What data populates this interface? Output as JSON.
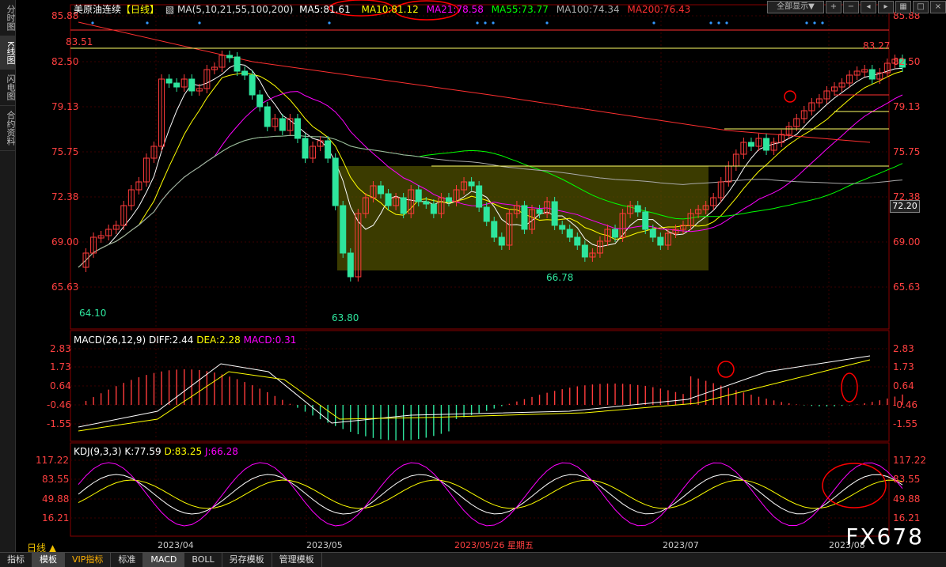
{
  "left_tabs": [
    {
      "label": "分时图",
      "active": false
    },
    {
      "label": "K线图",
      "active": true
    },
    {
      "label": "闪电图",
      "active": false
    },
    {
      "label": "合约资料",
      "active": false
    }
  ],
  "header": {
    "instrument": "美原油连续",
    "period_tag": "【日线】",
    "ma_title": "MA(5,10,21,55,100,200)",
    "ma_values": [
      {
        "text": "MA5:81.61",
        "color": "#ffffff"
      },
      {
        "text": "MA10:81.12",
        "color": "#ffff00"
      },
      {
        "text": "MA21:78.58",
        "color": "#ff00ff"
      },
      {
        "text": "MA55:73.77",
        "color": "#00ff00"
      },
      {
        "text": "MA100:74.34",
        "color": "#aaaaaa"
      },
      {
        "text": "MA200:76.43",
        "color": "#ff3030"
      }
    ]
  },
  "toolbar": {
    "select_label": "全部显示▼",
    "icons": [
      "plus-icon",
      "minus-icon",
      "left-icon",
      "right-icon",
      "grid-icon",
      "box-icon",
      "close-icon"
    ]
  },
  "axes": {
    "price_ticks": [
      "85.88",
      "82.50",
      "79.13",
      "75.75",
      "72.38",
      "69.00",
      "65.63"
    ],
    "macd_ticks": [
      "2.83",
      "1.73",
      "0.64",
      "-0.46",
      "-1.55"
    ],
    "kdj_ticks": [
      "117.22",
      "83.55",
      "49.88",
      "16.21"
    ],
    "date_labels": [
      "2023/04",
      "2023/05",
      "2023/05/26 星期五",
      "2023/07",
      "2023/08"
    ],
    "current_price": "72.20"
  },
  "annotations": {
    "high1": "83.51",
    "low1": "64.10",
    "low2": "63.80",
    "low3": "66.78",
    "high2": "83.27"
  },
  "macd": {
    "title": "MACD(26,12,9)",
    "diff": "DIFF:2.44",
    "dea": "DEA:2.28",
    "macd": "MACD:0.31"
  },
  "kdj": {
    "title": "KDJ(9,3,3)",
    "k": "K:77.59",
    "d": "D:83.25",
    "j": "J:66.28"
  },
  "period_label": "日线 ▲",
  "bottom_tabs": [
    {
      "label": "指标",
      "active": false
    },
    {
      "label": "模板",
      "active": true
    },
    {
      "label": "VIP指标",
      "active": false
    },
    {
      "label": "标准",
      "active": false
    },
    {
      "label": "MACD",
      "active": true
    },
    {
      "label": "BOLL",
      "active": false
    },
    {
      "label": "另存模板",
      "active": false
    },
    {
      "label": "管理模板",
      "active": false
    }
  ],
  "watermark": "FX678",
  "colors": {
    "up": "#ff3b3b",
    "down": "#2ee59d",
    "grid": "#3a0000",
    "axis": "#880000"
  }
}
